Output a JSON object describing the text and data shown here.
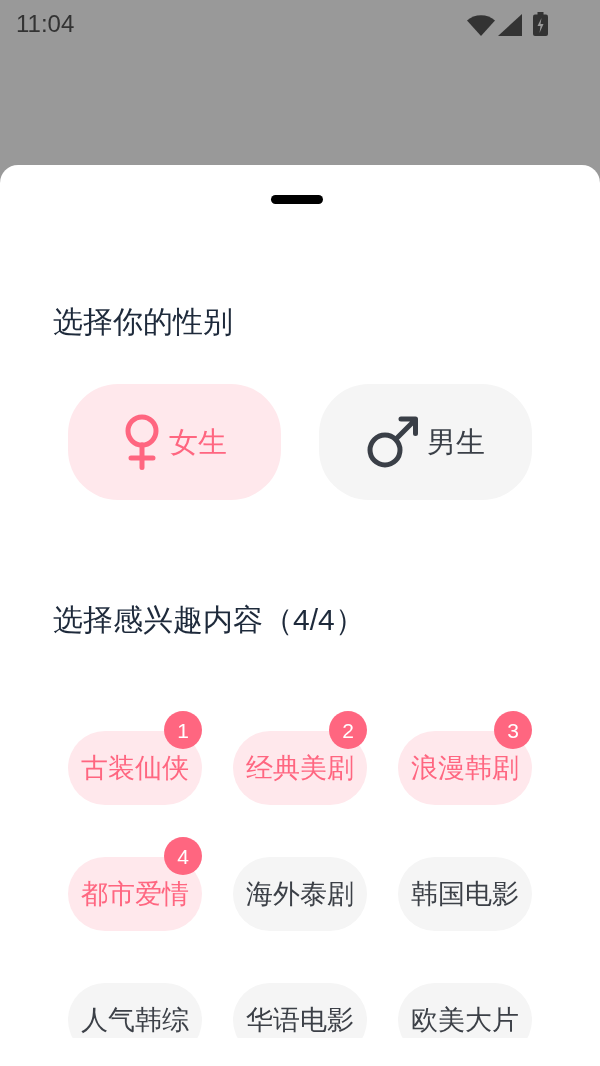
{
  "status_bar": {
    "time": "11:04"
  },
  "sheet": {
    "gender": {
      "title": "选择你的性别",
      "options": [
        {
          "label": "女生",
          "kind": "female",
          "selected": true
        },
        {
          "label": "男生",
          "kind": "male",
          "selected": false
        }
      ]
    },
    "interests": {
      "title": "选择感兴趣内容（4/4）",
      "tags": [
        {
          "label": "古装仙侠",
          "selected": true,
          "badge": "1"
        },
        {
          "label": "经典美剧",
          "selected": true,
          "badge": "2"
        },
        {
          "label": "浪漫韩剧",
          "selected": true,
          "badge": "3"
        },
        {
          "label": "都市爱情",
          "selected": true,
          "badge": "4"
        },
        {
          "label": "海外泰剧",
          "selected": false
        },
        {
          "label": "韩国电影",
          "selected": false
        },
        {
          "label": "人气韩综",
          "selected": false
        },
        {
          "label": "华语电影",
          "selected": false
        },
        {
          "label": "欧美大片",
          "selected": false
        }
      ]
    }
  }
}
